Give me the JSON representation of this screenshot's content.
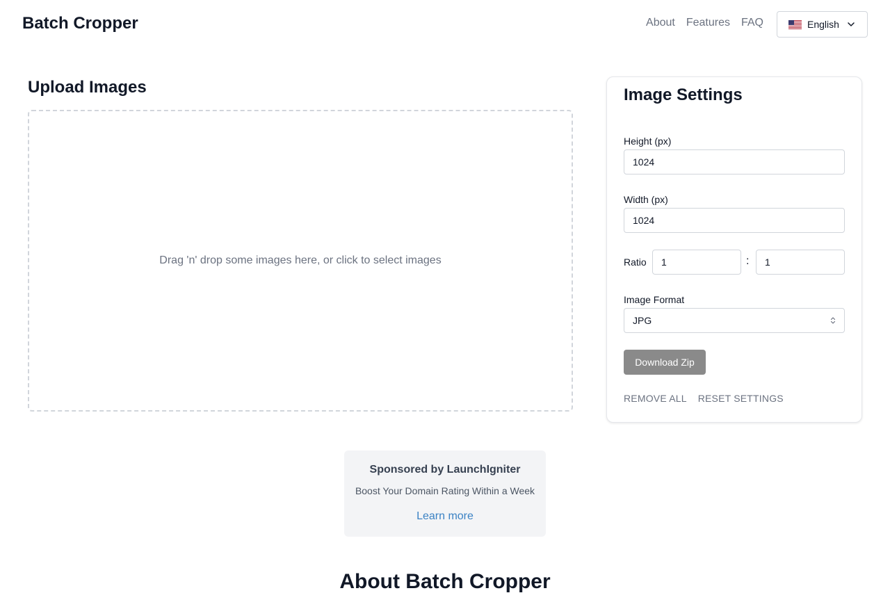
{
  "header": {
    "brand": "Batch Cropper",
    "nav": [
      "About",
      "Features",
      "FAQ"
    ],
    "language": "English"
  },
  "upload": {
    "title": "Upload Images",
    "dropzone_text": "Drag 'n' drop some images here, or click to select images"
  },
  "settings": {
    "title": "Image Settings",
    "height_label": "Height (px)",
    "height_value": "1024",
    "width_label": "Width (px)",
    "width_value": "1024",
    "ratio_label": "Ratio",
    "ratio_left": "1",
    "ratio_separator": ":",
    "ratio_right": "1",
    "format_label": "Image Format",
    "format_value": "JPG",
    "download_label": "Download Zip",
    "remove_all_label": "REMOVE ALL",
    "reset_label": "RESET SETTINGS"
  },
  "sponsor": {
    "title": "Sponsored by LaunchIgniter",
    "text": "Boost Your Domain Rating Within a Week",
    "link": "Learn more"
  },
  "about": {
    "title": "About Batch Cropper"
  },
  "colors": {
    "link": "#3b82c4",
    "button_disabled": "#8a8a8a",
    "muted_text": "#6b7280"
  }
}
